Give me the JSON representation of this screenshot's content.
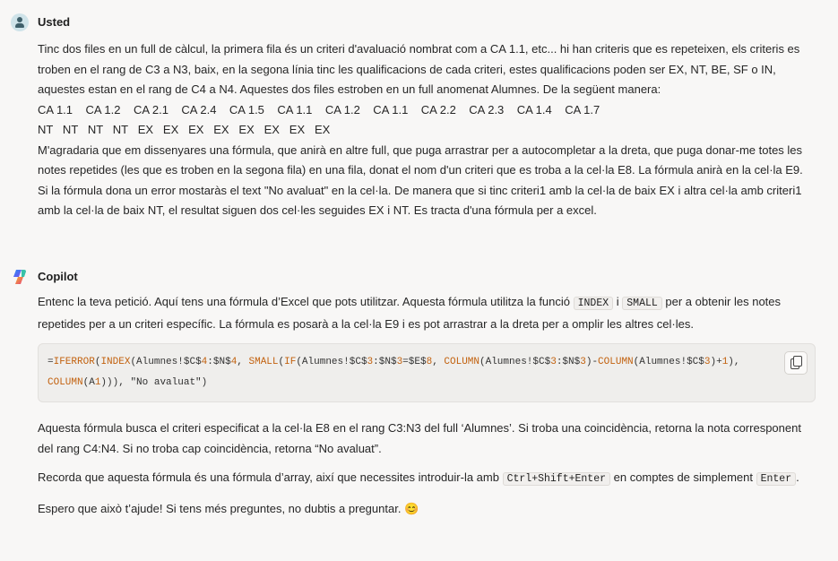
{
  "user": {
    "author": "Usted",
    "paragraph1": "Tinc dos files en un full de càlcul, la primera fila és un criteri d'avaluació nombrat com a CA 1.1, etc... hi han criteris que es repeteixen, els criteris es troben en el rang de C3 a N3, baix, en la segona línia tinc les qualificacions de cada criteri, estes qualificacions poden ser EX, NT, BE, SF o IN, aquestes estan en el rang de C4 a N4. Aquestes dos files estroben en un full anomenat Alumnes. De la següent manera:",
    "criteria_row": "CA 1.1    CA 1.2    CA 2.1    CA 2.4    CA 1.5    CA 1.1    CA 1.2    CA 1.1    CA 2.2    CA 2.3    CA 1.4    CA 1.7",
    "grades_row": "NT   NT   NT   NT   EX   EX   EX   EX   EX   EX   EX   EX",
    "paragraph2": "M'agradaria que em dissenyares una fórmula, que anirà en altre full, que puga arrastrar per a autocompletar a la dreta, que puga donar-me totes les notes repetides (les que es troben en la segona fila) en una fila, donat el nom d'un criteri que es troba a la cel·la E8. La fórmula anirà en la cel·la E9. Si la fórmula dona un error mostaràs el text \"No avaluat\" en la cel·la. De manera que si tinc criteri1 amb la cel·la de baix EX i altra cel·la amb criteri1 amb la cel·la de baix NT, el resultat siguen dos cel·les seguides EX i NT. Es tracta d'una fórmula per a excel."
  },
  "copilot": {
    "author": "Copilot",
    "intro_a": "Entenc la teva petició. Aquí tens una fórmula d’Excel que pots utilitzar. Aquesta fórmula utilitza la funció ",
    "code_index": "INDEX",
    "intro_b": " i ",
    "code_small": "SMALL",
    "intro_c": " per a obtenir les notes repetides per a un criteri específic. La fórmula es posarà a la cel·la E9 i es pot arrastrar a la dreta per a omplir les altres cel·les.",
    "formula_line1": "=IFERROR(INDEX(Alumnes!$C$4:$N$4, SMALL(IF(Alumnes!$C$3:$N$3=$E$8, COLUMN(Alumnes!$C$3:$N$3)-COLUMN(Alumnes!$C$3)+1),",
    "formula_line2": "COLUMN(A1))), \"No avaluat\")",
    "explanation": "Aquesta fórmula busca el criteri especificat a la cel·la E8 en el rang C3:N3 del full ‘Alumnes’. Si troba una coincidència, retorna la nota corresponent del rang C4:N4. Si no troba cap coincidència, retorna “No avaluat”.",
    "array_a": "Recorda que aquesta fórmula és una fórmula d’array, així que necessites introduir-la amb ",
    "key_combo": "Ctrl+Shift+Enter",
    "array_b": " en comptes de simplement ",
    "key_enter": "Enter",
    "array_c": ".",
    "closing": "Espero que això t’ajude! Si tens més preguntes, no dubtis a preguntar. 😊"
  },
  "colors": {
    "accent_code": "#c2610e",
    "background": "#f8f7f6"
  }
}
